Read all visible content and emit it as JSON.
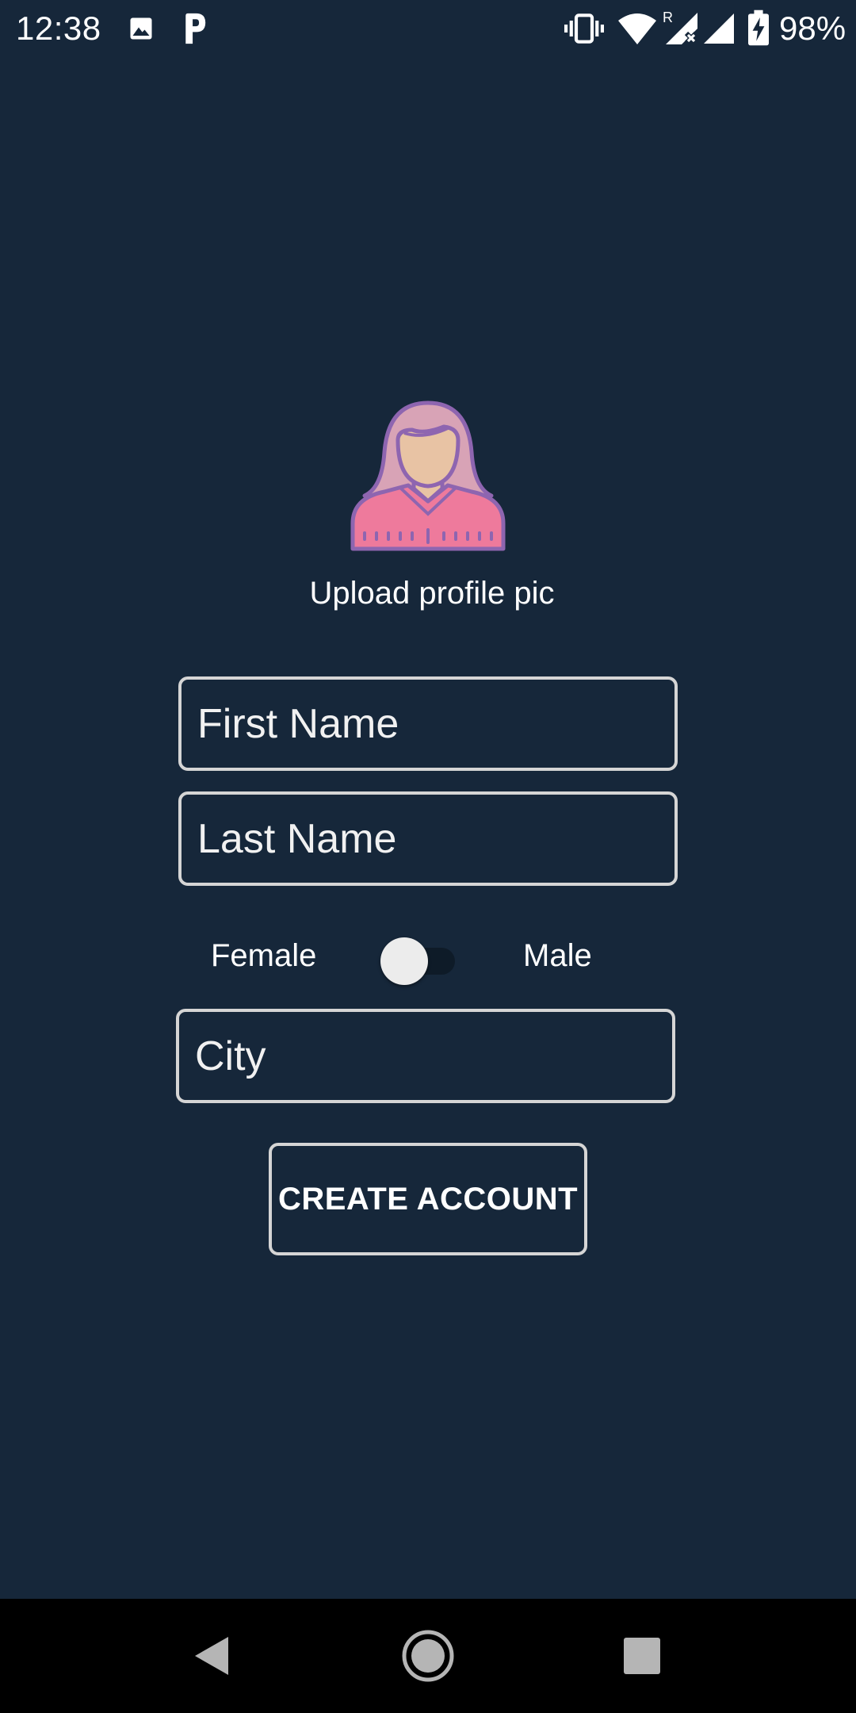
{
  "status_bar": {
    "time": "12:38",
    "battery_percent": "98%",
    "icons": [
      "image-icon",
      "parking-icon",
      "vibrate-icon",
      "wifi-icon",
      "signal-roaming-icon",
      "signal-icon",
      "battery-charging-icon"
    ]
  },
  "profile": {
    "avatar_icon": "female-avatar-icon",
    "upload_label": "Upload profile pic"
  },
  "form": {
    "first_name": {
      "placeholder": "First Name",
      "value": ""
    },
    "last_name": {
      "placeholder": "Last Name",
      "value": ""
    },
    "gender": {
      "left_label": "Female",
      "right_label": "Male",
      "checked": false
    },
    "city": {
      "placeholder": "City",
      "value": ""
    },
    "submit_label": "CREATE ACCOUNT"
  },
  "nav_bar": {
    "icons": [
      "back-icon",
      "home-icon",
      "recents-icon"
    ]
  },
  "colors": {
    "background": "#16273a",
    "field_border": "#d5d5d5",
    "text": "#ffffff",
    "avatar_hair": "#d8a3b6",
    "avatar_face": "#e8c3a4",
    "avatar_shirt": "#ee7a9c",
    "avatar_outline": "#8e65b0"
  }
}
